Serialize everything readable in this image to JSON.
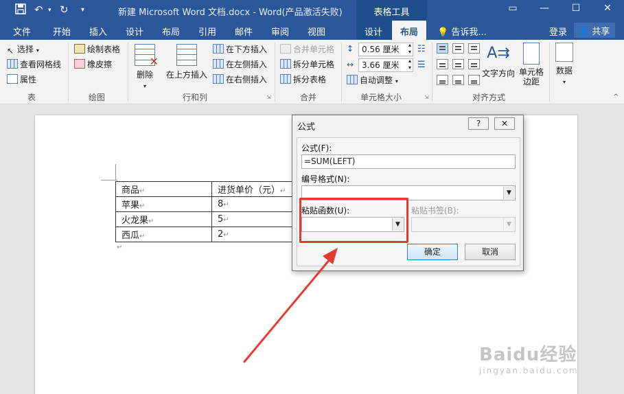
{
  "titlebar": {
    "doc_title": "新建 Microsoft Word 文档.docx - Word(产品激活失败)",
    "context_tab": "表格工具",
    "save_icon": "save-icon",
    "undo_icon": "undo-icon",
    "redo_icon": "redo-icon"
  },
  "tabs": {
    "file": "文件",
    "home": "开始",
    "insert": "插入",
    "design": "设计",
    "layout": "布局",
    "references": "引用",
    "mailings": "邮件",
    "review": "审阅",
    "view": "视图",
    "table_design": "设计",
    "table_layout": "布局",
    "tell_me": "告诉我...",
    "login": "登录",
    "share": "共享"
  },
  "ribbon": {
    "groups": {
      "table": "表",
      "draw": "绘图",
      "rows_cols": "行和列",
      "merge": "合并",
      "cell_size": "单元格大小",
      "alignment": "对齐方式"
    },
    "select": "选择",
    "view_gridlines": "查看网格线",
    "properties": "属性",
    "draw_table": "绘制表格",
    "eraser": "橡皮擦",
    "delete": "删除",
    "insert_above": "在上方插入",
    "insert_below": "在下方插入",
    "insert_left": "在左侧插入",
    "insert_right": "在右侧插入",
    "merge_cells": "合并单元格",
    "split_cells": "拆分单元格",
    "split_table": "拆分表格",
    "height_value": "0.56 厘米",
    "width_value": "3.66 厘米",
    "autofit": "自动调整",
    "text_direction": "文字方向",
    "cell_margins": "单元格\n边距",
    "data": "数据"
  },
  "document": {
    "table": [
      [
        "商品",
        "进货单价（元）"
      ],
      [
        "苹果",
        "8"
      ],
      [
        "火龙果",
        "5"
      ],
      [
        "西瓜",
        "2"
      ]
    ]
  },
  "dialog": {
    "title": "公式",
    "help": "?",
    "close": "✕",
    "formula_label": "公式(F):",
    "formula_value": "=SUM(LEFT)",
    "number_format_label": "编号格式(N):",
    "number_format_value": "",
    "paste_function_label": "粘贴函数(U):",
    "paste_function_value": "",
    "paste_bookmark_label": "粘贴书签(B):",
    "ok": "确定",
    "cancel": "取消"
  },
  "annotation": {
    "color": "#e53a32"
  },
  "watermark": {
    "line1": "Baidu经验",
    "line2": "jingyan.baidu.com"
  }
}
